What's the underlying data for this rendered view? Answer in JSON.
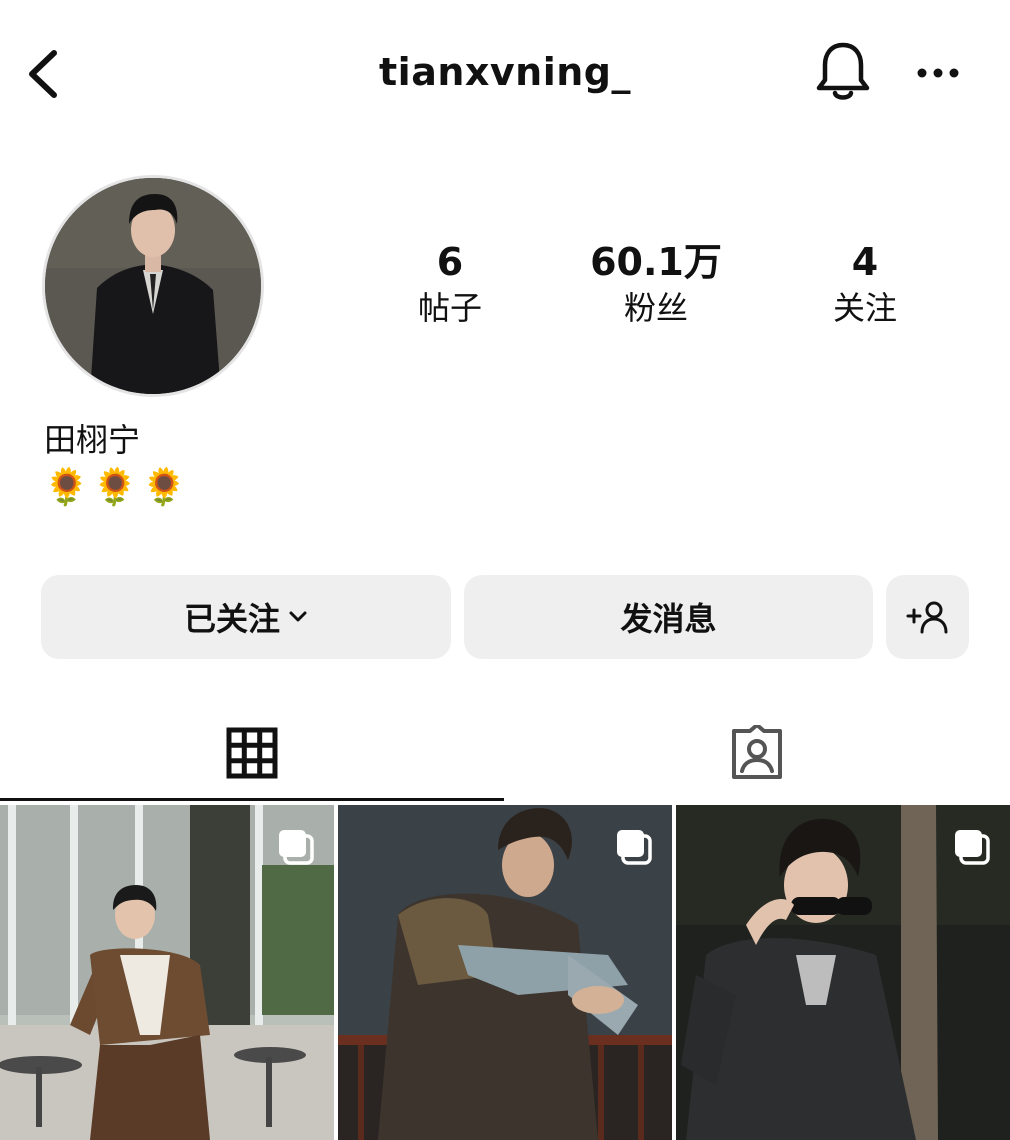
{
  "header": {
    "username": "tianxvning_",
    "back_icon": "chevron-left-icon",
    "notification_icon": "bell-icon",
    "more_icon": "more-horizontal-icon"
  },
  "profile": {
    "display_name": "田栩宁",
    "bio": "🌻🌻🌻"
  },
  "stats": [
    {
      "value": "6",
      "label": "帖子"
    },
    {
      "value": "60.1万",
      "label": "粉丝"
    },
    {
      "value": "4",
      "label": "关注"
    }
  ],
  "actions": {
    "following_label": "已关注",
    "message_label": "发消息",
    "add_user_icon": "add-user-icon"
  },
  "tabs": [
    {
      "icon": "grid-icon",
      "selected": true
    },
    {
      "icon": "tagged-person-icon",
      "selected": false
    }
  ],
  "grid": {
    "posts": [
      {
        "type": "carousel",
        "icon": "multiple-posts-icon"
      },
      {
        "type": "carousel",
        "icon": "multiple-posts-icon"
      },
      {
        "type": "carousel",
        "icon": "multiple-posts-icon"
      }
    ]
  },
  "colors": {
    "button_background": "#efefef",
    "text": "#111111",
    "background": "#ffffff"
  }
}
